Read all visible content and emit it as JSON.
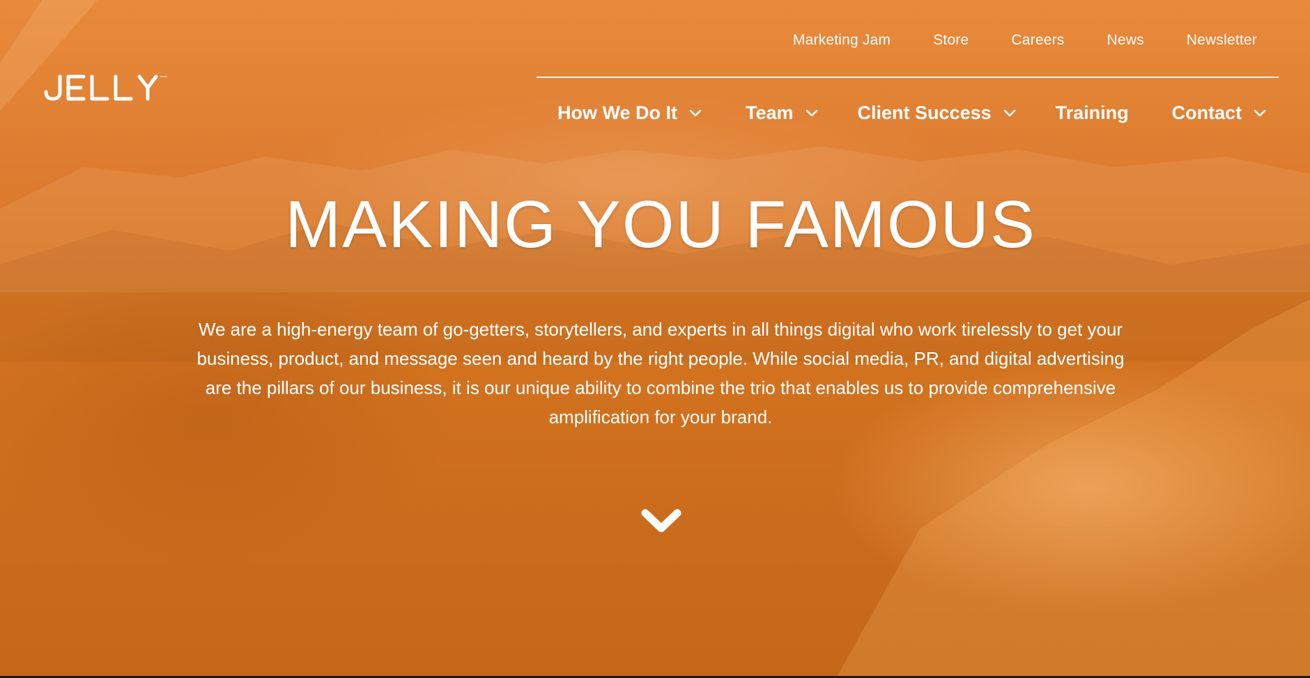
{
  "brand": {
    "logo_text": "JELLY"
  },
  "top_nav": {
    "items": [
      {
        "label": "Marketing Jam"
      },
      {
        "label": "Store"
      },
      {
        "label": "Careers"
      },
      {
        "label": "News"
      },
      {
        "label": "Newsletter"
      }
    ]
  },
  "main_nav": {
    "items": [
      {
        "label": "How We Do It",
        "has_dropdown": true
      },
      {
        "label": "Team",
        "has_dropdown": true
      },
      {
        "label": "Client Success",
        "has_dropdown": true
      },
      {
        "label": "Training",
        "has_dropdown": false
      },
      {
        "label": "Contact",
        "has_dropdown": true
      }
    ]
  },
  "hero": {
    "headline": "MAKING YOU FAMOUS",
    "intro": "We are a high-energy team of go-getters, storytellers, and experts in all things digital who work tirelessly to get your business, product, and message seen and heard by the right people. While social media, PR, and digital advertising are the pillars of our business, it is our unique ability to combine the trio that enables us to provide comprehensive amplification for your brand.",
    "scroll_icon": "chevron-down-icon"
  },
  "colors": {
    "overlay": "#dd7c30",
    "text": "#ffffff"
  }
}
